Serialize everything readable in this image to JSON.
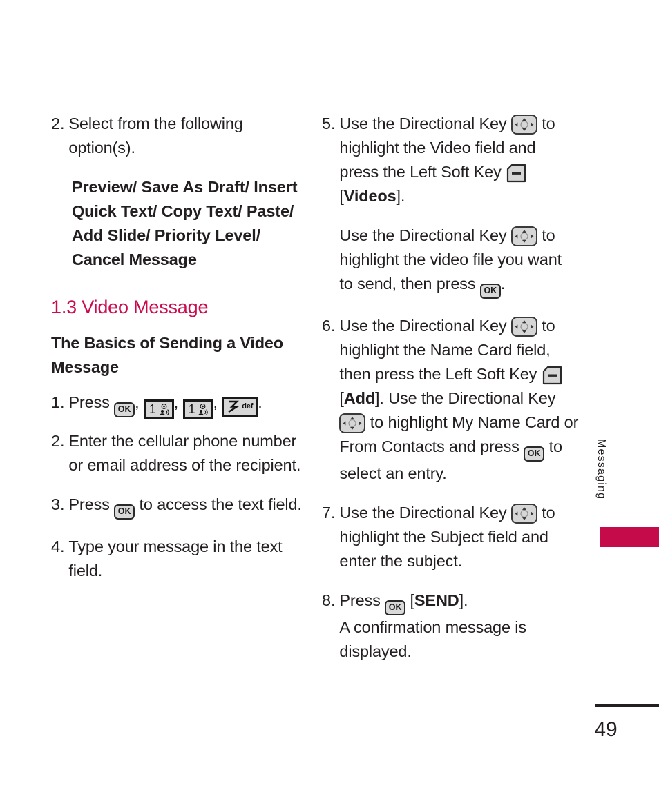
{
  "page": {
    "number": "49",
    "side_tab_label": "Messaging",
    "accent_color": "#cc0b4e",
    "tab_bar_color": "#c60b4b"
  },
  "icons": {
    "ok_label": "OK",
    "key1_alpha": "",
    "key3_alpha": "def",
    "key1_digit": "1",
    "key3_digit": "3"
  },
  "left_column": {
    "item2": {
      "number": "2.",
      "text": "Select from the following option(s)."
    },
    "options_list": "Preview/ Save As Draft/ Insert Quick Text/ Copy Text/ Paste/ Add Slide/ Priority Level/ Cancel Message",
    "section_heading": "1.3 Video Message",
    "sub_heading": "The Basics of Sending a Video Message",
    "item1": {
      "number": "1.",
      "prefix": "Press",
      "sep1": ",",
      "sep2": ",",
      "sep3": ",",
      "suffix": "."
    },
    "item2b": {
      "number": "2.",
      "text": "Enter the cellular phone number or email address of the recipient."
    },
    "item3": {
      "number": "3.",
      "prefix": "Press",
      "suffix": "to access the text field."
    },
    "item4": {
      "number": "4.",
      "text": "Type your message in the text field."
    }
  },
  "right_column": {
    "item5": {
      "number": "5.",
      "part1": "Use the Directional Key",
      "part2": "to highlight the Video field and press the Left Soft Key",
      "bracket_open": "[",
      "label": "Videos",
      "bracket_close": "].",
      "sub_part1": "Use the Directional Key",
      "sub_part2": "to highlight the video file you want to send, then press",
      "sub_suffix": "."
    },
    "item6": {
      "number": "6.",
      "part1": "Use the Directional Key",
      "part2": "to highlight the Name Card field, then press the Left Soft Key",
      "part3": "Key",
      "bracket_open": "[",
      "label": "Add",
      "bracket_close": "].",
      "part4": "Use the Directional Key",
      "part5": "to",
      "part6": "highlight My Name Card or From Contacts and press",
      "part7": "to select an entry."
    },
    "item7": {
      "number": "7.",
      "part1": "Use the Directional Key",
      "part2": "to highlight the Subject field and enter the subject."
    },
    "item8": {
      "number": "8.",
      "prefix": "Press",
      "bracket_open": "[",
      "label": "SEND",
      "bracket_close": "].",
      "text": "A confirmation message is displayed."
    }
  }
}
